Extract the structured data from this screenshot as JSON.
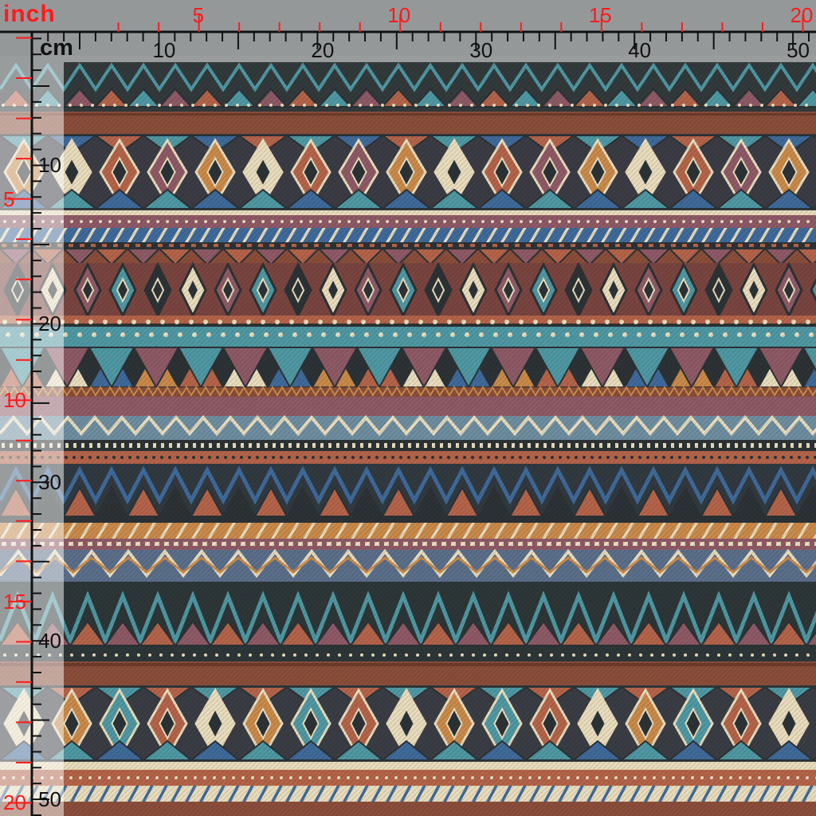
{
  "image": {
    "subject": "tribal geometric fabric swatch with measurement rulers",
    "colors": {
      "dark": "#2c3235",
      "rust": "#b4644a",
      "brown": "#8a4e3a",
      "teal": "#4f98a3",
      "blue": "#3f6a9a",
      "cream": "#e8dcbd",
      "ochre": "#c98a4a",
      "mauve": "#8e5a66",
      "inch_label": "#ff1a1a",
      "cm_label": "#111111"
    }
  },
  "ruler": {
    "inch_unit": "inch",
    "cm_unit": "cm",
    "inch_top_labels": [
      "5",
      "10",
      "15",
      "20"
    ],
    "cm_top_labels": [
      "10",
      "20",
      "30",
      "40",
      "50"
    ],
    "inch_left_labels": [
      "5",
      "10",
      "15",
      "20"
    ],
    "cm_left_labels": [
      "10",
      "20",
      "30",
      "40",
      "50"
    ]
  }
}
